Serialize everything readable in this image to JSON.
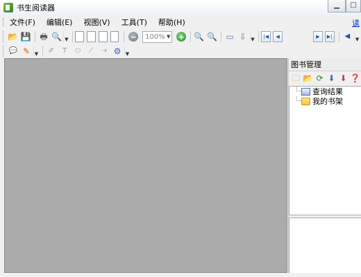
{
  "window": {
    "title": "书生阅读器"
  },
  "menu": {
    "items": [
      "文件(F)",
      "编辑(E)",
      "视图(V)",
      "工具(T)",
      "帮助(H)"
    ],
    "right_link": "读"
  },
  "toolbar": {
    "zoom_value": "100%",
    "icons": [
      "open-icon",
      "save-icon",
      "print-icon",
      "find-icon",
      "page-single-icon",
      "page-continuous-icon",
      "page-facing-icon",
      "page-book-icon",
      "zoom-out-icon",
      "zoom-in-icon",
      "magnify-icon",
      "magnify-minus-icon",
      "fit-width-icon",
      "fit-page-icon",
      "first-page-icon",
      "prev-page-icon",
      "next-page-icon",
      "last-page-icon",
      "back-icon"
    ]
  },
  "toolbar2": {
    "icons": [
      "comment-icon",
      "stamp-icon",
      "pen-icon",
      "text-tool-icon",
      "ellipse-icon",
      "line-icon",
      "arrow-line-icon",
      "settings-icon"
    ]
  },
  "side_panel": {
    "title": "图书管理",
    "tree": [
      {
        "label": "查询结果",
        "icon": "search-folder-icon"
      },
      {
        "label": "我的书架",
        "icon": "folder-icon"
      }
    ]
  }
}
